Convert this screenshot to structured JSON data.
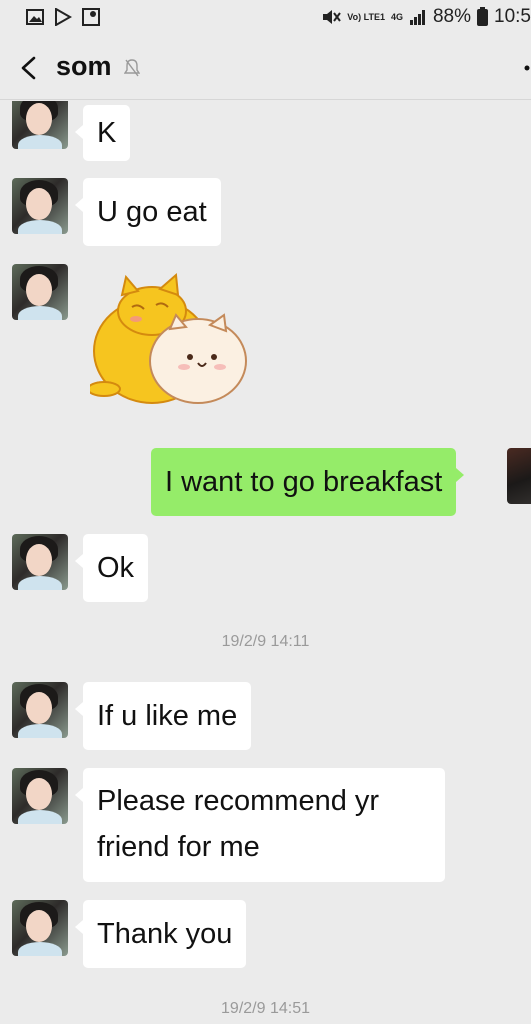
{
  "status_bar": {
    "network": "Vo) LTE1",
    "network_type": "4G",
    "battery": "88%",
    "time": "10:5"
  },
  "header": {
    "title": "som"
  },
  "messages": [
    {
      "from": "them",
      "text": "K"
    },
    {
      "from": "them",
      "text": "U go eat"
    },
    {
      "from": "them",
      "sticker": "cat-hug-sticker"
    },
    {
      "from": "me",
      "text": "I want to go breakfast"
    },
    {
      "from": "them",
      "text": "Ok"
    },
    {
      "from": "them",
      "text": "If u like me"
    },
    {
      "from": "them",
      "text": "Please recommend yr friend for me"
    },
    {
      "from": "them",
      "text": "Thank you"
    }
  ],
  "timestamps": [
    "19/2/9 14:11",
    "19/2/9 14:51"
  ],
  "colors": {
    "background": "#ebebeb",
    "my_bubble": "#95ec69",
    "their_bubble": "#ffffff"
  }
}
